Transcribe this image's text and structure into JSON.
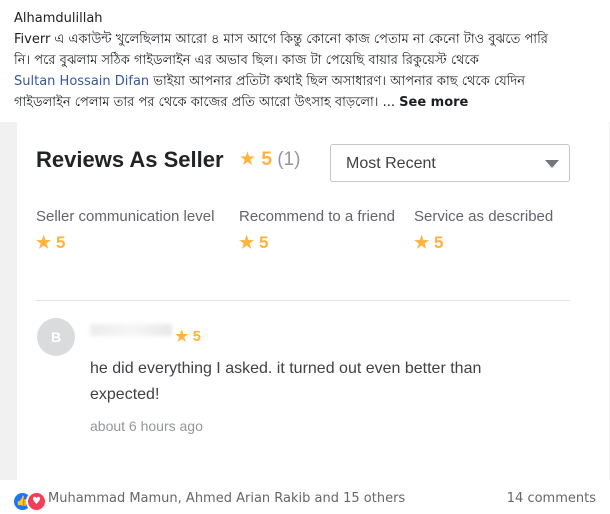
{
  "post": {
    "line1": "Alhamdulillah",
    "line2": "Fiverr এ একাউন্ট খুলেছিলাম আরো ৪ মাস আগে কিন্তু কোনো কাজ পেতাম না কেনো টাও বুঝতে পারি",
    "line3": "নি। পরে  বুঝলাম সঠিক গাইডলাইন এর অভাব ছিল। কাজ টা পেয়েছি বায়ার রিকুয়েস্ট থেকে",
    "mention": "Sultan Hossain Difan",
    "line4_rest": " ভাইয়া আপনার প্রতিটা কথাই ছিল অসাধারণ। আপনার কাছ থেকে যেদিন",
    "line5": "গাইডলাইন পেলাম তার পর থেকে কাজের প্রতি আরো উৎসাহ বাড়লো। ...",
    "see_more": "See more"
  },
  "reviews": {
    "title": "Reviews As Seller",
    "star_glyph": "★",
    "rating": "5",
    "count": "(1)",
    "sort_selected": "Most Recent",
    "categories": [
      {
        "label": "Seller communication level",
        "rating": "5"
      },
      {
        "label": "Recommend to a friend",
        "rating": "5"
      },
      {
        "label": "Service as described",
        "rating": "5"
      }
    ],
    "review": {
      "avatar_letter": "B",
      "rating": "5",
      "text": "he did everything I asked. it turned out even better than expected!",
      "time": "about 6 hours ago"
    }
  },
  "footer": {
    "reactors": "Muhammad Mamun, Ahmed Arian Rakib and 15 others",
    "comments": "14 comments"
  },
  "colors": {
    "star": "#ffb33e",
    "mention": "#385898",
    "like": "#1877f2",
    "love": "#f33e58"
  }
}
